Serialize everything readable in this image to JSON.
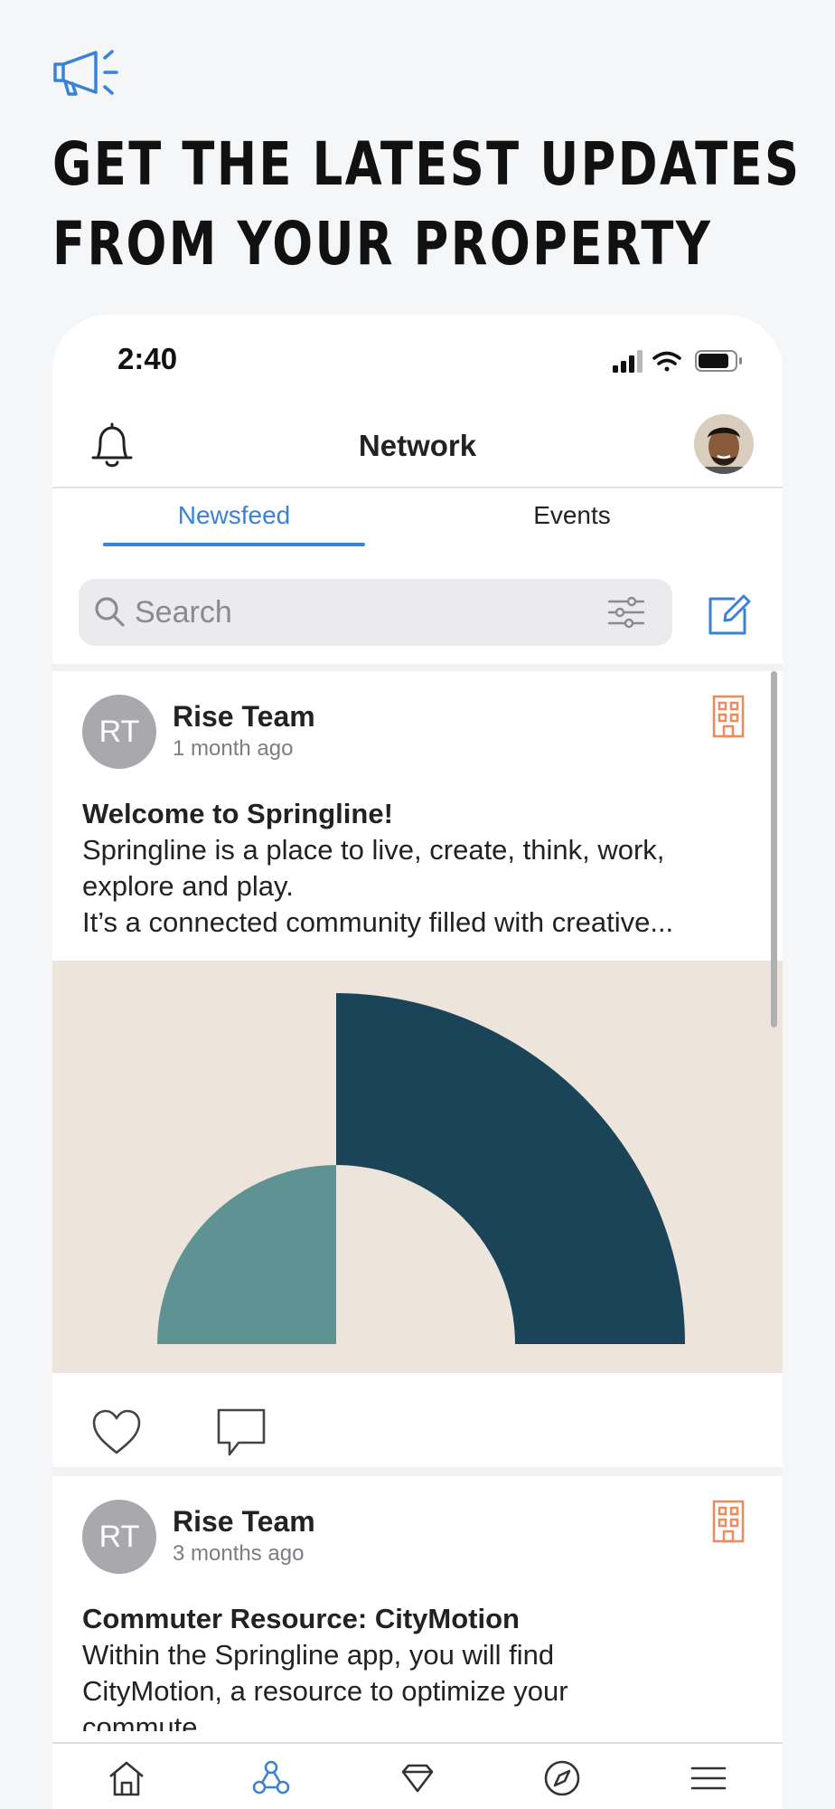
{
  "promo": {
    "headline_line1": "GET THE LATEST UPDATES",
    "headline_line2": "FROM YOUR PROPERTY",
    "icon": "megaphone-icon"
  },
  "status_bar": {
    "time": "2:40"
  },
  "header": {
    "title": "Network",
    "left_icon": "bell-icon",
    "right": "avatar"
  },
  "tabs": [
    {
      "label": "Newsfeed",
      "active": true
    },
    {
      "label": "Events",
      "active": false
    }
  ],
  "search": {
    "placeholder": "Search"
  },
  "posts": [
    {
      "initials": "RT",
      "author": "Rise Team",
      "time": "1 month ago",
      "title": "Welcome to Springline!",
      "body_line1": "Springline is a place to live, create, think, work,",
      "body_line2": "explore and play.",
      "body_line3": "It’s a connected community filled with creative..."
    },
    {
      "initials": "RT",
      "author": "Rise Team",
      "time": "3 months ago",
      "title": "Commuter Resource: CityMotion",
      "body_line1": "Within the Springline app, you will find",
      "body_line2": "CityMotion, a resource to optimize your",
      "body_line3": "commute...."
    }
  ],
  "colors": {
    "accent": "#3a82d6",
    "building_icon": "#f08a5d",
    "image_bg": "#ede4dc",
    "image_dark": "#1b4459",
    "image_teal": "#5f9393"
  },
  "bottom_nav": [
    "home-icon",
    "network-icon",
    "diamond-icon",
    "compass-icon",
    "menu-icon"
  ]
}
